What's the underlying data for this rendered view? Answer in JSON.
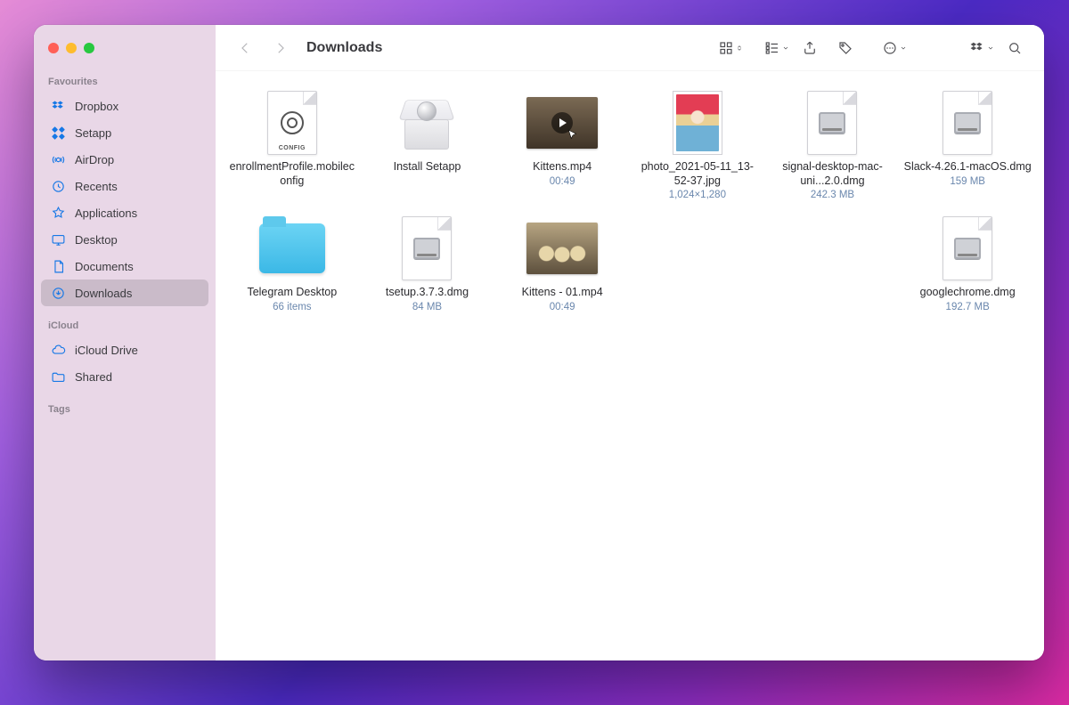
{
  "window": {
    "title": "Downloads"
  },
  "sidebar": {
    "sections": {
      "favourites": "Favourites",
      "icloud": "iCloud",
      "tags": "Tags"
    },
    "favourites": [
      {
        "label": "Dropbox",
        "icon": "dropbox"
      },
      {
        "label": "Setapp",
        "icon": "setapp"
      },
      {
        "label": "AirDrop",
        "icon": "airdrop"
      },
      {
        "label": "Recents",
        "icon": "recents"
      },
      {
        "label": "Applications",
        "icon": "applications"
      },
      {
        "label": "Desktop",
        "icon": "desktop"
      },
      {
        "label": "Documents",
        "icon": "documents"
      },
      {
        "label": "Downloads",
        "icon": "downloads",
        "active": true
      }
    ],
    "icloud": [
      {
        "label": "iCloud Drive",
        "icon": "icloud"
      },
      {
        "label": "Shared",
        "icon": "shared"
      }
    ]
  },
  "files": [
    {
      "name": "enrollmentProfile.mobileconfig",
      "type": "config",
      "meta": ""
    },
    {
      "name": "Install Setapp",
      "type": "package",
      "meta": ""
    },
    {
      "name": "Kittens.mp4",
      "type": "video",
      "meta": "00:49",
      "overlay": "play"
    },
    {
      "name": "photo_2021-05-11_13-52-37.jpg",
      "type": "photo",
      "meta": "1,024×1,280"
    },
    {
      "name": "signal-desktop-mac-uni...2.0.dmg",
      "type": "dmg",
      "meta": "242.3 MB"
    },
    {
      "name": "Slack-4.26.1-macOS.dmg",
      "type": "dmg",
      "meta": "159 MB"
    },
    {
      "name": "Telegram Desktop",
      "type": "folder",
      "meta": "66 items"
    },
    {
      "name": "tsetup.3.7.3.dmg",
      "type": "dmg",
      "meta": "84 MB"
    },
    {
      "name": "Kittens - 01.mp4",
      "type": "video-cats",
      "meta": "00:49"
    },
    {
      "name": "googlechrome.dmg",
      "type": "dmg",
      "meta": "192.7 MB"
    }
  ],
  "config_badge": "CONFIG"
}
